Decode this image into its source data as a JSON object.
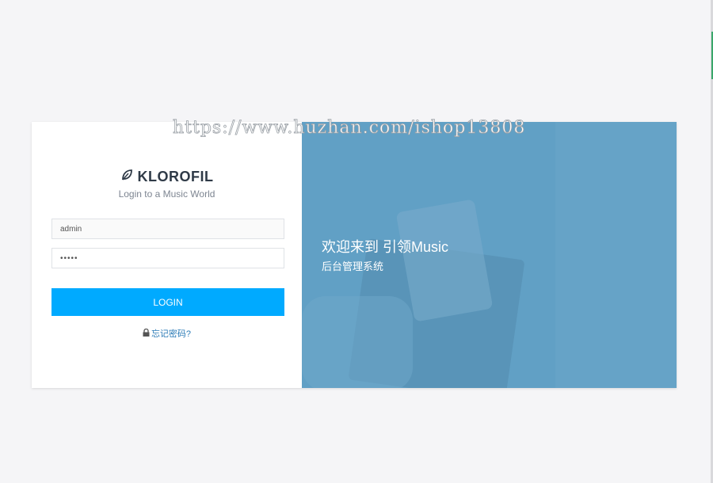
{
  "login": {
    "brand": "KLOROFIL",
    "tagline": "Login to a Music World",
    "username_value": "admin",
    "password_value": "•••••",
    "login_label": "LOGIN",
    "forgot_label": "忘记密码?"
  },
  "promo": {
    "welcome": "欢迎来到 引领Music",
    "subtitle": "后台管理系统"
  },
  "watermark": "https://www.huzhan.com/ishop13808",
  "colors": {
    "accent": "#00aaff",
    "promo_bg": "#6ba6c9",
    "page_bg": "#f5f5f7"
  },
  "icons": {
    "brand": "leaf-icon",
    "forgot": "lock-icon"
  }
}
